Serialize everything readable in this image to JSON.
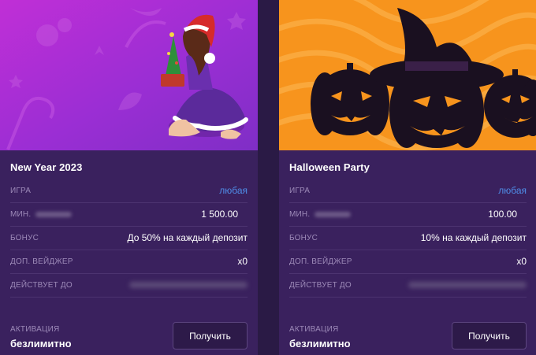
{
  "promos": [
    {
      "title": "New Year 2023",
      "game_label": "ИГРА",
      "game_value": "любая",
      "min_label": "МИН.",
      "min_value": "1 500.00",
      "bonus_label": "БОНУС",
      "bonus_value": "До 50% на каждый депозит",
      "wager_label": "ДОП. ВЕЙДЖЕР",
      "wager_value": "x0",
      "valid_label": "ДЕЙСТВУЕТ ДО",
      "activation_label": "АКТИВАЦИЯ",
      "activation_value": "безлимитно",
      "button_label": "Получить",
      "accent": "#a630d8"
    },
    {
      "title": "Halloween Party",
      "game_label": "ИГРА",
      "game_value": "любая",
      "min_label": "МИН.",
      "min_value": "100.00",
      "bonus_label": "БОНУС",
      "bonus_value": "10% на каждый депозит",
      "wager_label": "ДОП. ВЕЙДЖЕР",
      "wager_value": "x0",
      "valid_label": "ДЕЙСТВУЕТ ДО",
      "activation_label": "АКТИВАЦИЯ",
      "activation_value": "безлимитно",
      "button_label": "Получить",
      "accent": "#f7941d"
    }
  ],
  "colors": {
    "page_bg": "#2a1a45",
    "card_bg": "#3a215e",
    "link": "#4f8de8",
    "label": "#9d8ab8"
  },
  "icons": [
    "christmas-girl-illustration",
    "pumpkin-witch-hat-illustration"
  ]
}
